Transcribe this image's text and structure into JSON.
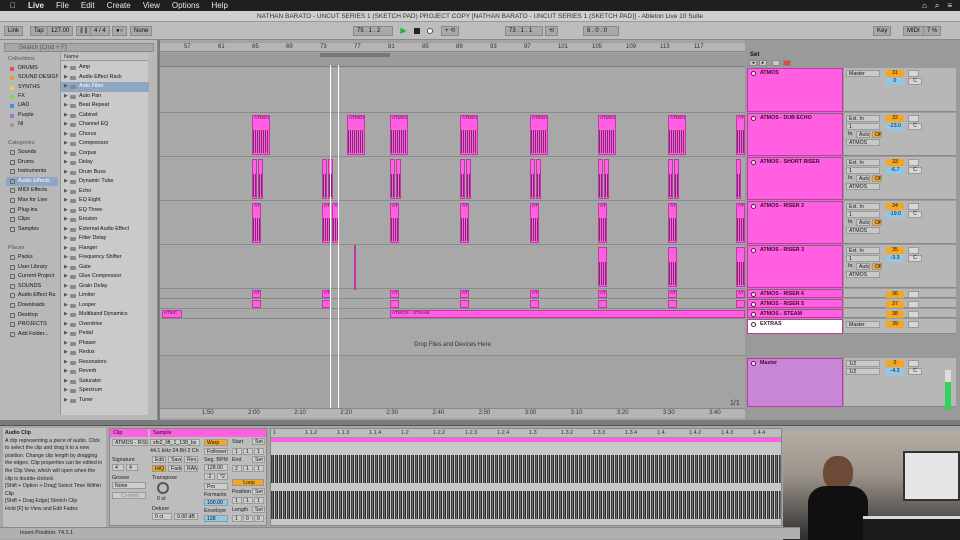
{
  "menubar": {
    "app": "Live",
    "items": [
      "File",
      "Edit",
      "Create",
      "View",
      "Options",
      "Help"
    ],
    "right": [
      "⌂",
      "⌕",
      "≡"
    ]
  },
  "titlebar": {
    "text": "NATHAN BARATO - UNCUT SERIES 1 (SKETCH PAD) PROJECT COPY  [NATHAN BARATO - UNCUT SERIES 1 (SKETCH PAD)] - Ableton Live 10 Suite"
  },
  "transport": {
    "link": "Link",
    "tap": "Tap",
    "tempo": "127.00",
    "signature": "4 / 4",
    "quantize": "None",
    "arrangement_position": "75 .  1 .  2",
    "loop_start": "73 .  1 .  1",
    "loop_length": "8 .  0 .  0",
    "key": "Key",
    "midi": "MIDI",
    "cpu": "7 %",
    "colors": {
      "play": "#1fb22e"
    }
  },
  "browser": {
    "search_placeholder": "Search (Cmd + F)",
    "collections_label": "Collections",
    "collections": [
      {
        "label": "DRUMS",
        "color": "#e24e4e"
      },
      {
        "label": "SOUND DESIGN",
        "color": "#f09a2a"
      },
      {
        "label": "SYNTHS",
        "color": "#e9d246"
      },
      {
        "label": "FX",
        "color": "#8ad04a"
      },
      {
        "label": "UAD",
        "color": "#3d8ef0"
      },
      {
        "label": "Purple",
        "color": "#a467e6"
      },
      {
        "label": "NI",
        "color": "#9a9a9a"
      }
    ],
    "categories_label": "Categories",
    "categories": [
      "Sounds",
      "Drums",
      "Instruments",
      "Audio Effects",
      "MIDI Effects",
      "Max for Live",
      "Plug-ins",
      "Clips",
      "Samples"
    ],
    "places_label": "Places",
    "places": [
      "Packs",
      "User Library",
      "Current Project",
      "SOUNDS",
      "Audio Effect Ra",
      "Downloads",
      "Desktop",
      "PROJECTS",
      "Add Folder..."
    ],
    "name_header": "Name",
    "effects": [
      "Amp",
      "Audio Effect Rack",
      "Auto Filter",
      "Auto Pan",
      "Beat Repeat",
      "Cabinet",
      "Channel EQ",
      "Chorus",
      "Compressor",
      "Corpus",
      "Delay",
      "Drum Buss",
      "Dynamic Tube",
      "Echo",
      "EQ Eight",
      "EQ Three",
      "Erosion",
      "External Audio Effect",
      "Filter Delay",
      "Flanger",
      "Frequency Shifter",
      "Gate",
      "Glue Compressor",
      "Grain Delay",
      "Limiter",
      "Looper",
      "Multiband Dynamics",
      "Overdrive",
      "Pedal",
      "Phaser",
      "Redux",
      "Resonators",
      "Reverb",
      "Saturator",
      "Spectrum",
      "Tuner"
    ]
  },
  "arrangement": {
    "bar_ticks": [
      "57",
      "61",
      "65",
      "69",
      "73",
      "77",
      "81",
      "85",
      "89",
      "93",
      "97",
      "101",
      "105",
      "109",
      "113",
      "117"
    ],
    "time_ticks": [
      "1:50",
      "2:00",
      "2:10",
      "2:20",
      "2:30",
      "2:40",
      "2:50",
      "3:00",
      "3:10",
      "3:20",
      "3:30",
      "3:40"
    ],
    "drop_text": "Drop Files and Devices Here",
    "page": "1/1",
    "clip_names": {
      "dub": "ATMOS",
      "riser": "ATMOS",
      "r6": "ATI",
      "steam": "ATMOS - STEAM",
      "steam_short": "ATMC"
    }
  },
  "mixer": {
    "set_label": "Set",
    "tracks": [
      {
        "name": "ATMOS",
        "input": "Master",
        "num": "31",
        "vol": "0",
        "pan": "C"
      },
      {
        "name": "ATMOS - DUB ECHO",
        "input": "Ext. In",
        "ch": "1",
        "mode": "Auto",
        "route": "ATMOS",
        "num": "32",
        "vol": "-23.0",
        "pan": "C"
      },
      {
        "name": "ATMOS - SHORT RISER",
        "input": "Ext. In",
        "ch": "1",
        "mode": "Auto",
        "route": "ATMOS",
        "num": "33",
        "vol": "-6.7",
        "pan": "C"
      },
      {
        "name": "ATMOS - RISER 2",
        "input": "Ext. In",
        "ch": "1",
        "mode": "Auto",
        "route": "ATMOS",
        "num": "34",
        "vol": "-19.0",
        "pan": "C"
      },
      {
        "name": "ATMOS - RISER 3",
        "input": "Ext. In",
        "ch": "1",
        "mode": "Auto",
        "route": "ATMOS",
        "num": "35",
        "vol": "-3.3",
        "pan": "C"
      },
      {
        "name": "ATMOS - RISER 6",
        "num": "36"
      },
      {
        "name": "ATMOS - RISER 5",
        "num": "37"
      },
      {
        "name": "ATMOS - STEAM",
        "num": "38"
      },
      {
        "name": "EXTRAS",
        "input": "Master",
        "num": "39",
        "vol": "0",
        "pan": "C"
      },
      {
        "name": "Master",
        "input": "1/2",
        "out": "1/2",
        "vol": "-4.3",
        "num": "0",
        "pan": "C"
      }
    ],
    "in_label": "In",
    "off_label": "Off"
  },
  "detail": {
    "info_title": "Audio Clip",
    "info_text": "A clip representing a piece of audio. Click to select the clip and drag it to a new position. Change clip length by dragging the edges. Clip properties can be edited in the Clip View, which will open when the clip is double-clicked.",
    "info_shortcut1": "[Shift + Option + Drag] Select Time Within Clip",
    "info_shortcut2": "[Shift + Drag Edge] Stretch Clip",
    "info_shortcut3": "Hold [F] to View and Edit Fades",
    "clip_tab": "Clip",
    "sample_tab": "Sample",
    "clip_name": "ATMOS - RISE",
    "sample_name": "sfx2_lift_1_138_bs",
    "sample_info": "44.1 kHz 24 Bit 2 Ch",
    "signature_label": "Signature",
    "sig_num": "4",
    "sig_den": "4",
    "groove_label": "Groove",
    "groove_value": "None",
    "commit": "Commit",
    "edit": "Edit",
    "save": "Save",
    "rev": "Rev.",
    "hiq": "HiQ",
    "fade": "Fade",
    "ram": "RAM",
    "warp": "Warp",
    "follower": "Follower",
    "seg_bpm_label": "Seg. BPM",
    "seg_bpm": "128.00",
    "half": ":2",
    "double": "*2",
    "transpose_label": "Transpose",
    "transpose_value": "0 st",
    "detune_label": "Detune",
    "detune_value": "0 ct",
    "gain_value": "0.00 dB",
    "pro": "Pro",
    "formants_label": "Formants",
    "formants_value": "100.00",
    "envelope_label": "Envelope",
    "envelope_value": "128",
    "start_label": "Start",
    "set_label": "Set",
    "start_vals": [
      "1",
      "1",
      "1"
    ],
    "end_label": "End",
    "end_vals": [
      "2",
      "1",
      "1"
    ],
    "loop": "Loop",
    "position_label": "Position",
    "position_vals": [
      "1",
      "1",
      "1"
    ],
    "length_label": "Length",
    "length_vals": [
      "1",
      "0",
      "0"
    ],
    "sample_ruler": [
      "1",
      "1.1.2",
      "1.1.3",
      "1.1.4",
      "1.2",
      "1.2.2",
      "1.2.3",
      "1.2.4",
      "1.3",
      "1.3.2",
      "1.3.3",
      "1.3.4",
      "1.4",
      "1.4.2",
      "1.4.3",
      "1.4.4"
    ],
    "status": "Insert Position: 74.1.1"
  }
}
